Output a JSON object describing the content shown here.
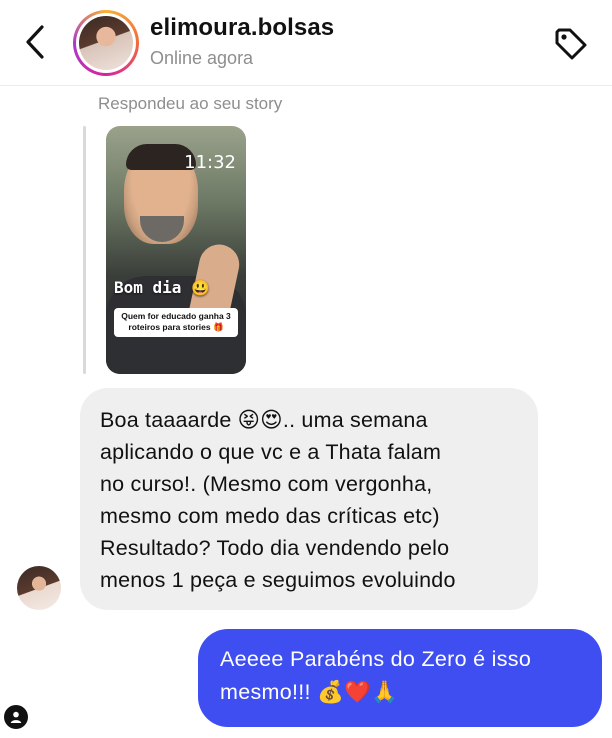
{
  "header": {
    "username": "elimoura.bolsas",
    "status": "Online agora",
    "back_icon": "chevron-left-icon",
    "tag_icon": "tag-icon"
  },
  "story_reply": {
    "label": "Respondeu ao seu story",
    "time": "11:32",
    "caption": "Bom dia",
    "caption_emoji": "😃",
    "sticker_text": "Quem for educado ganha 3 roteiros para stories 🎁"
  },
  "messages": [
    {
      "direction": "incoming",
      "text": "Boa taaaarde 😝😍.. uma semana\naplicando o que vc e a Thata falam\nno curso!. (Mesmo com vergonha,\nmesmo com medo das críticas etc)\nResultado? Todo dia vendendo pelo\nmenos 1 peça e seguimos evoluindo"
    },
    {
      "direction": "outgoing",
      "text": "Aeeee Parabéns do Zero é isso\nmesmo!!! 💰❤️🙏"
    }
  ],
  "colors": {
    "outgoing_bubble": "#3e4ef1",
    "incoming_bubble": "#efefef",
    "secondary_text": "#8e8e8e"
  }
}
